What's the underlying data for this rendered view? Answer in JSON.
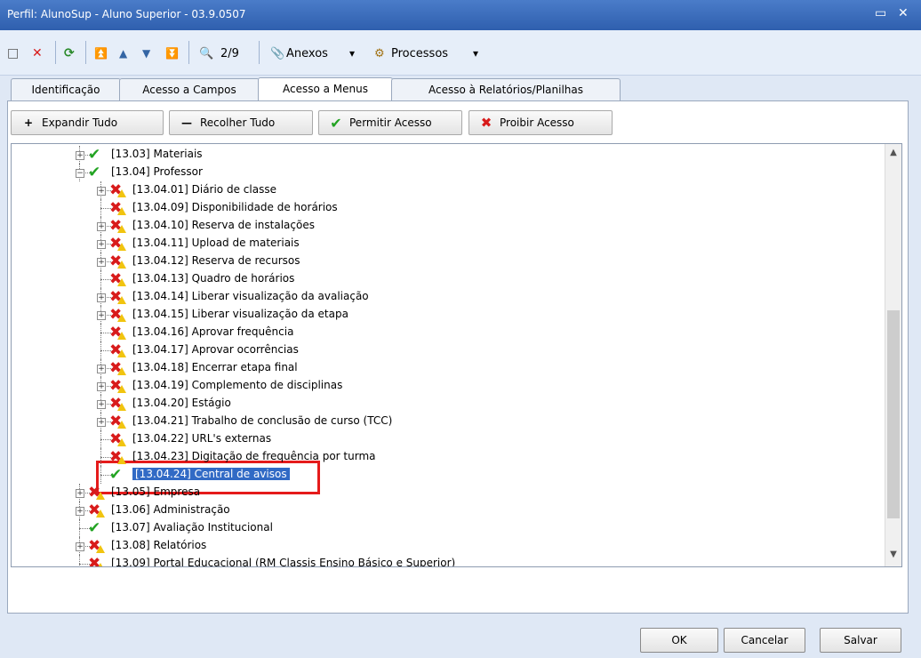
{
  "window": {
    "title": "Perfil: AlunoSup - Aluno Superior - 03.9.0507",
    "restore_glyph": "▭",
    "close_glyph": "✕"
  },
  "toolbar": {
    "new_icon": "□",
    "delete_icon": "✕",
    "refresh_icon": "⟳",
    "first_icon": "⏫",
    "prev_icon": "▲",
    "next_icon": "▼",
    "last_icon": "⏬",
    "find_icon": "🔍",
    "record_position": "2/9",
    "attachments_icon": "📎",
    "attachments_label": "Anexos",
    "processes_icon": "⚙",
    "processes_label": "Processos",
    "dropdown_glyph": "▾"
  },
  "tabs": [
    "Identificação",
    "Acesso a Campos",
    "Acesso a Menus",
    "Acesso à Relatórios/Planilhas"
  ],
  "actions": {
    "expand": {
      "icon": "+",
      "label": "Expandir Tudo"
    },
    "collapse": {
      "icon": "—",
      "label": "Recolher Tudo"
    },
    "allow": {
      "icon": "✔",
      "label": "Permitir Acesso"
    },
    "deny": {
      "icon": "✖",
      "label": "Proibir Acesso"
    }
  },
  "tree": {
    "items": [
      {
        "label": "[13.03] Materiais",
        "status": "ok",
        "expander": "+"
      },
      {
        "label": "[13.04] Professor",
        "status": "ok",
        "expander": "−"
      },
      {
        "label": "[13.04.01] Diário de classe",
        "status": "no",
        "expander": "+"
      },
      {
        "label": "[13.04.09] Disponibilidade de horários",
        "status": "no",
        "expander": ""
      },
      {
        "label": "[13.04.10] Reserva de instalações",
        "status": "no",
        "expander": "+"
      },
      {
        "label": "[13.04.11] Upload de materiais",
        "status": "no",
        "expander": "+"
      },
      {
        "label": "[13.04.12] Reserva de recursos",
        "status": "no",
        "expander": "+"
      },
      {
        "label": "[13.04.13] Quadro de horários",
        "status": "no",
        "expander": ""
      },
      {
        "label": "[13.04.14] Liberar visualização da avaliação",
        "status": "no",
        "expander": "+"
      },
      {
        "label": "[13.04.15] Liberar visualização da etapa",
        "status": "no",
        "expander": "+"
      },
      {
        "label": "[13.04.16] Aprovar frequência",
        "status": "no",
        "expander": ""
      },
      {
        "label": "[13.04.17] Aprovar ocorrências",
        "status": "no",
        "expander": ""
      },
      {
        "label": "[13.04.18] Encerrar etapa final",
        "status": "no",
        "expander": "+"
      },
      {
        "label": "[13.04.19] Complemento de disciplinas",
        "status": "no",
        "expander": "+"
      },
      {
        "label": "[13.04.20] Estágio",
        "status": "no",
        "expander": "+"
      },
      {
        "label": "[13.04.21] Trabalho de conclusão de curso (TCC)",
        "status": "no",
        "expander": "+"
      },
      {
        "label": "[13.04.22] URL's externas",
        "status": "no",
        "expander": ""
      },
      {
        "label": "[13.04.23] Digitação de frequência por turma",
        "status": "no",
        "expander": ""
      },
      {
        "label": "[13.04.24] Central de avisos",
        "status": "ok",
        "expander": "",
        "selected": true
      },
      {
        "label": "[13.05] Empresa",
        "status": "no",
        "expander": "+"
      },
      {
        "label": "[13.06] Administração",
        "status": "no",
        "expander": "+"
      },
      {
        "label": "[13.07] Avaliação Institucional",
        "status": "ok",
        "expander": ""
      },
      {
        "label": "[13.08] Relatórios",
        "status": "no",
        "expander": "+"
      },
      {
        "label": "[13.09] Portal Educacional (RM Classis Ensino Básico e Superior)",
        "status": "no",
        "expander": ""
      }
    ],
    "scroll_up_glyph": "▲",
    "scroll_down_glyph": "▼"
  },
  "footer": {
    "ok_label": "OK",
    "cancel_label": "Cancelar",
    "save_label": "Salvar"
  }
}
